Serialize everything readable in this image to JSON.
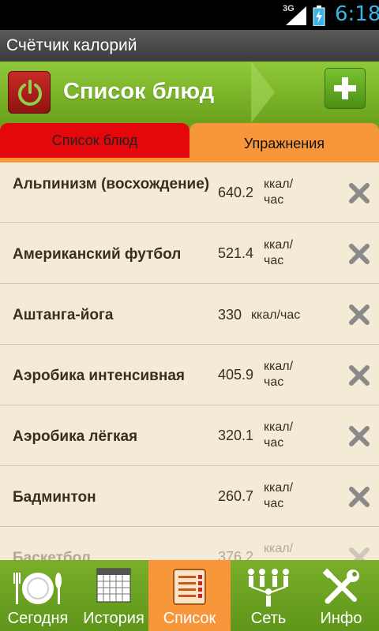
{
  "status": {
    "network": "3G",
    "time": "6:18"
  },
  "app_title": "Счётчик калорий",
  "header": {
    "title": "Список блюд"
  },
  "tabs": [
    {
      "label": "Список блюд",
      "active": false
    },
    {
      "label": "Упражнения",
      "active": true
    }
  ],
  "exercises": [
    {
      "name": "Альпинизм (восхождение)",
      "value": "640.2",
      "unit": "ккал/час"
    },
    {
      "name": "Американский футбол",
      "value": "521.4",
      "unit": "ккал/час"
    },
    {
      "name": "Аштанга-йога",
      "value": "330",
      "unit": "ккал/час"
    },
    {
      "name": "Аэробика интенсивная",
      "value": "405.9",
      "unit": "ккал/час"
    },
    {
      "name": "Аэробика лёгкая",
      "value": "320.1",
      "unit": "ккал/час"
    },
    {
      "name": "Бадминтон",
      "value": "260.7",
      "unit": "ккал/час"
    },
    {
      "name": "Баскетбол",
      "value": "376.2",
      "unit": "ккал/час"
    }
  ],
  "bottom_nav": [
    {
      "label": "Сегодня",
      "icon": "plate-icon",
      "active": false
    },
    {
      "label": "История",
      "icon": "calendar-icon",
      "active": false
    },
    {
      "label": "Список",
      "icon": "list-icon",
      "active": true
    },
    {
      "label": "Сеть",
      "icon": "people-icon",
      "active": false
    },
    {
      "label": "Инфо",
      "icon": "tools-icon",
      "active": false
    }
  ],
  "colors": {
    "accent_green": "#6aa21b",
    "active_orange": "#f7963b",
    "foods_tab_red": "#e4070b",
    "list_bg": "#f4ebd6"
  }
}
